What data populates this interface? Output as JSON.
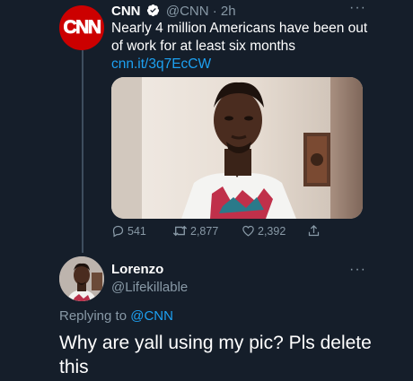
{
  "tweet": {
    "author_name": "CNN",
    "author_handle": "@CNN",
    "separator": "·",
    "time": "2h",
    "more": "···",
    "logo_text": "CNN",
    "text": "Nearly 4 million Americans have been out of work for at least six months ",
    "link": "cnn.it/3q7EcCW",
    "actions": {
      "reply_count": "541",
      "retweet_count": "2,877",
      "like_count": "2,392"
    }
  },
  "reply": {
    "author_name": "Lorenzo",
    "author_handle": "@Lifekillable",
    "more": "···",
    "replying_prefix": "Replying to ",
    "replying_to": "@CNN",
    "text": "Why are yall using my pic? Pls delete this"
  },
  "colors": {
    "background": "#151e2a",
    "secondary_text": "#8899a6",
    "link": "#1da1f2",
    "cnn_red": "#cc0000"
  },
  "icons": [
    "verified-badge-icon",
    "reply-icon",
    "retweet-icon",
    "like-icon",
    "share-icon",
    "more-icon"
  ]
}
